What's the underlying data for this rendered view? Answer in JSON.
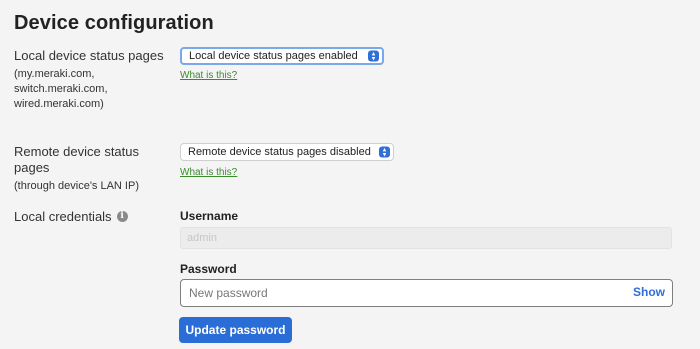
{
  "page": {
    "title": "Device configuration"
  },
  "local_status": {
    "label": "Local device status pages",
    "sub": "(my.meraki.com, switch.meraki.com, wired.meraki.com)",
    "select_value": "Local device status pages enabled",
    "help_link": "What is this?"
  },
  "remote_status": {
    "label": "Remote device status pages",
    "sub": "(through device's LAN IP)",
    "select_value": "Remote device status pages disabled",
    "help_link": "What is this?"
  },
  "credentials": {
    "label": "Local credentials",
    "info_icon": "info-icon",
    "username_label": "Username",
    "username_value": "admin",
    "password_label": "Password",
    "password_placeholder": "New password",
    "show_label": "Show",
    "update_button": "Update password"
  },
  "colors": {
    "background": "#f4f4f4",
    "link": "#3b8b2e",
    "primary": "#2a6dd6"
  }
}
